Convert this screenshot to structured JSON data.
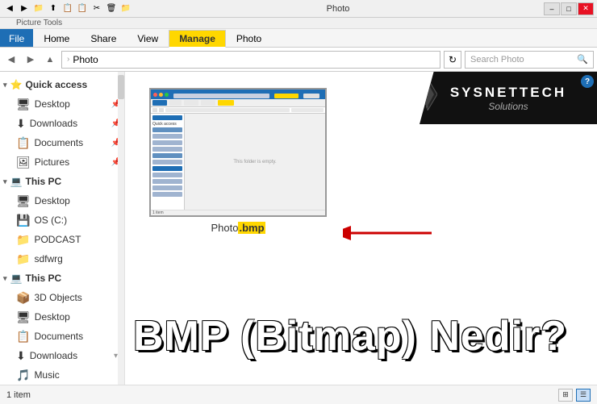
{
  "titlebar": {
    "path": "Photo"
  },
  "ribbon": {
    "tabs": [
      {
        "id": "file",
        "label": "File",
        "type": "file"
      },
      {
        "id": "home",
        "label": "Home"
      },
      {
        "id": "share",
        "label": "Share"
      },
      {
        "id": "view",
        "label": "View"
      },
      {
        "id": "manage",
        "label": "Manage",
        "type": "manage"
      },
      {
        "id": "photo",
        "label": "Photo"
      }
    ],
    "picture_tools_label": "Picture Tools"
  },
  "address_bar": {
    "path": "Photo",
    "breadcrumb_arrow": "›",
    "search_placeholder": "Search Photo"
  },
  "sidebar": {
    "quick_access_label": "Quick access",
    "items": [
      {
        "id": "desktop-qa",
        "label": "Desktop",
        "icon": "🖥",
        "pinned": true
      },
      {
        "id": "downloads-qa",
        "label": "Downloads",
        "icon": "⬇",
        "pinned": true
      },
      {
        "id": "documents-qa",
        "label": "Documents",
        "icon": "📋",
        "pinned": true
      },
      {
        "id": "pictures-qa",
        "label": "Pictures",
        "icon": "🖼",
        "pinned": true
      },
      {
        "id": "this-pc",
        "label": "This PC",
        "icon": "💻"
      },
      {
        "id": "desktop-pc",
        "label": "Desktop",
        "icon": "🖥"
      },
      {
        "id": "os-c",
        "label": "OS (C:)",
        "icon": "💾"
      },
      {
        "id": "podcast",
        "label": "PODCAST",
        "icon": "📁"
      },
      {
        "id": "sdfwrg",
        "label": "sdfwrg",
        "icon": "📁"
      },
      {
        "id": "this-pc-2",
        "label": "This PC",
        "icon": "💻"
      },
      {
        "id": "3d-objects",
        "label": "3D Objects",
        "icon": "📦"
      },
      {
        "id": "desktop-pc2",
        "label": "Desktop",
        "icon": "🖥"
      },
      {
        "id": "documents-pc",
        "label": "Documents",
        "icon": "📋"
      },
      {
        "id": "downloads-pc",
        "label": "Downloads",
        "icon": "⬇"
      },
      {
        "id": "music",
        "label": "Music",
        "icon": "🎵"
      }
    ]
  },
  "content": {
    "file_name": "Photo",
    "file_ext": ".bmp",
    "file_label_prefix": "Photo",
    "file_label_ext": "bmp",
    "thumbnail_empty_text": "This folder is empty.",
    "arrow_color": "#cc0000"
  },
  "overlay": {
    "big_text": "BMP (Bitmap) Nedir?"
  },
  "logo": {
    "line1": "SYSNETTECH",
    "line2": "Solutions"
  },
  "status_bar": {
    "item_count": "1 item",
    "view_large_label": "Large icons",
    "view_detail_label": "Details"
  }
}
